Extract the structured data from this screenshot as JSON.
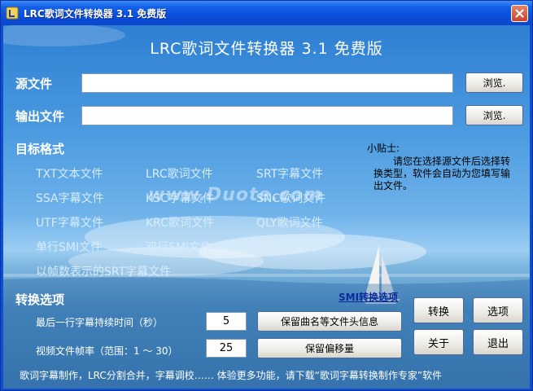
{
  "window": {
    "title": "LRC歌词文件转换器 3.1 免费版",
    "app_heading": "LRC歌词文件转换器 3.1 免费版"
  },
  "source": {
    "label": "源文件",
    "value": "",
    "browse_label": "浏览."
  },
  "output": {
    "label": "输出文件",
    "value": "",
    "browse_label": "浏览."
  },
  "target_format": {
    "heading": "目标格式",
    "options": [
      "TXT文本文件",
      "LRC歌词文件",
      "SRT字幕文件",
      "SSA字幕文件",
      "KSC字幕文件",
      "SNC歌词文件",
      "UTF字幕文件",
      "KRC歌词文件",
      "QLY歌词文件",
      "单行SMI文件",
      "双行SMI文件",
      "以帧数表示的SRT字幕文件"
    ]
  },
  "tip": {
    "title": "小贴士:",
    "text": "请您在选择源文件后选择转换类型，软件会自动为您填写输出文件。"
  },
  "options_section": {
    "heading": "转换选项",
    "smi_link": "SMI转换选项",
    "last_line_label": "最后一行字幕持续时间（秒）",
    "last_line_value": "5",
    "frame_rate_label": "视频文件帧率（范围：1 ～ 30）",
    "frame_rate_value": "25",
    "keep_header_button": "保留曲名等文件头信息",
    "keep_offset_button": "保留偏移量"
  },
  "actions": {
    "convert": "转换",
    "options": "选项",
    "about": "关于",
    "exit": "退出"
  },
  "footer": "歌词字幕制作，LRC分割合并，字幕调校…… 体验更多功能，请下载“歌词字幕转换制作专家”软件",
  "watermark": "www.Duote.com",
  "colors": {
    "titlebar": "#0b4fdc",
    "sky": "#4c9be0",
    "link": "#0a2a9c"
  }
}
